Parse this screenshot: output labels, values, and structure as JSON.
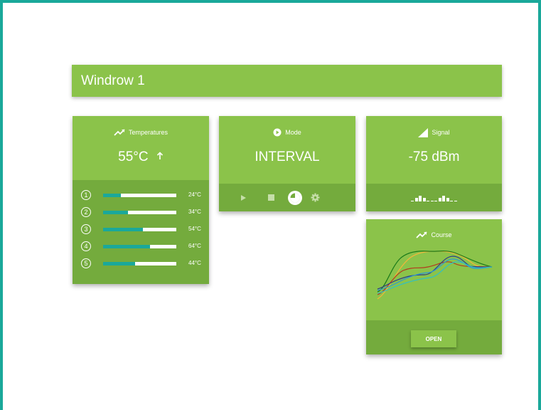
{
  "window_title": "Windrow 1",
  "temperatures": {
    "title": "Temperatures",
    "value": "55°C",
    "trend_icon": "arrow-up-icon",
    "sensors": [
      {
        "id": "1",
        "value": "24°C",
        "level": 0.24
      },
      {
        "id": "2",
        "value": "34°C",
        "level": 0.34
      },
      {
        "id": "3",
        "value": "54°C",
        "level": 0.54
      },
      {
        "id": "4",
        "value": "64°C",
        "level": 0.64
      },
      {
        "id": "5",
        "value": "44°C",
        "level": 0.44
      }
    ]
  },
  "mode": {
    "title": "Mode",
    "value": "INTERVAL",
    "controls": [
      "play-icon",
      "stop-icon",
      "interval-icon",
      "settings-icon"
    ],
    "active_control": "interval-icon"
  },
  "signal": {
    "title": "Signal",
    "value": "-75 dBm",
    "history_levels": [
      0.1,
      0.5,
      0.9,
      0.5,
      0.1,
      0.1,
      0.1,
      0.5,
      0.9,
      0.5,
      0.1,
      0.1
    ]
  },
  "course": {
    "title": "Course",
    "open_label": "OPEN"
  },
  "colors": {
    "frame": "#1aa89a",
    "card": "#8bc34a",
    "card_bottom": "#74ab3d",
    "bar_fill": "#1aa89a",
    "white": "#ffffff"
  }
}
